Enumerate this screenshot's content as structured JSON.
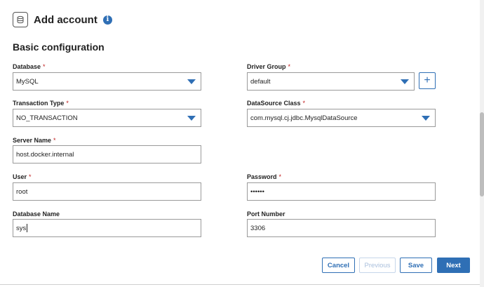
{
  "header": {
    "title": "Add account",
    "info_icon": "i"
  },
  "section": {
    "title": "Basic configuration"
  },
  "fields": {
    "database": {
      "label": "Database",
      "value": "MySQL"
    },
    "driver_group": {
      "label": "Driver Group",
      "value": "default"
    },
    "transaction_type": {
      "label": "Transaction Type",
      "value": "NO_TRANSACTION"
    },
    "datasource_class": {
      "label": "DataSource Class",
      "value": "com.mysql.cj.jdbc.MysqlDataSource"
    },
    "server_name": {
      "label": "Server Name",
      "value": "host.docker.internal"
    },
    "user": {
      "label": "User",
      "value": "root"
    },
    "password": {
      "label": "Password",
      "value": "••••••"
    },
    "database_name": {
      "label": "Database Name",
      "value": "sys"
    },
    "port_number": {
      "label": "Port Number",
      "value": "3306"
    }
  },
  "required_mark": "*",
  "plus_label": "+",
  "buttons": {
    "cancel": "Cancel",
    "previous": "Previous",
    "save": "Save",
    "next": "Next"
  },
  "colors": {
    "accent": "#2f6fb5",
    "required": "#c01d1d",
    "border": "#9a9a9a"
  },
  "icons": {
    "logo": "database-logo-icon",
    "info": "info-icon",
    "caret": "caret-down-icon",
    "add": "plus-icon"
  }
}
